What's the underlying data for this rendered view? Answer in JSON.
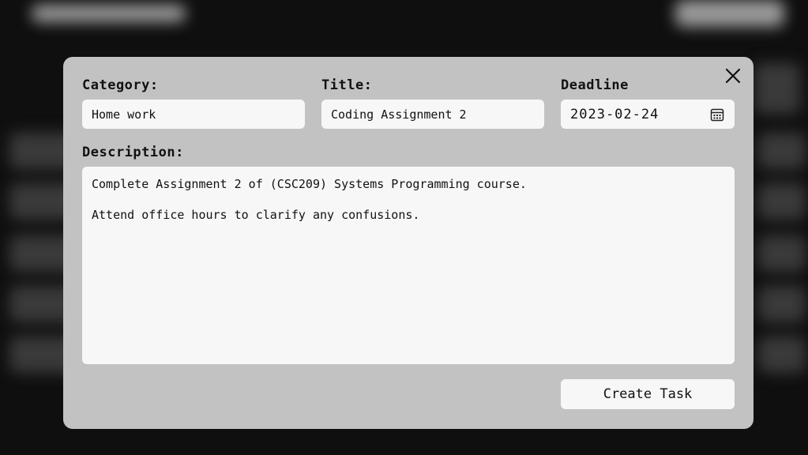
{
  "modal": {
    "category": {
      "label": "Category:",
      "value": "Home work"
    },
    "title": {
      "label": "Title:",
      "value": "Coding Assignment 2"
    },
    "deadline": {
      "label": "Deadline",
      "value": "2023-02-24"
    },
    "description": {
      "label": "Description:",
      "lines": [
        "Complete Assignment 2 of (CSC209) Systems Programming course.",
        "Attend office hours to clarify any confusions."
      ]
    },
    "create_label": "Create Task"
  },
  "icons": {
    "close": "close-icon",
    "calendar": "calendar-icon"
  }
}
